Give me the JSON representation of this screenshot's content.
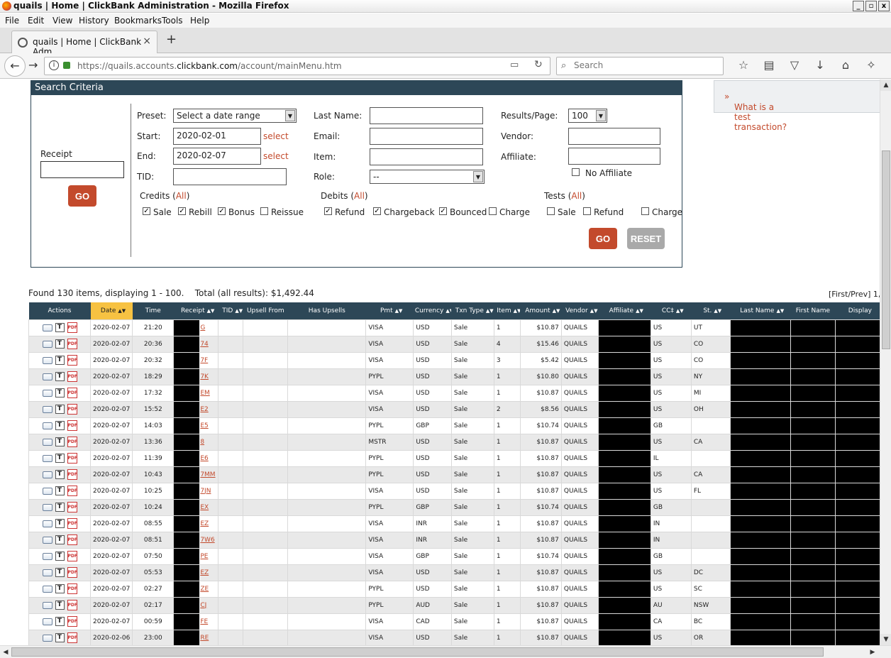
{
  "window": {
    "title": "quails | Home | ClickBank Administration - Mozilla Firefox",
    "buttons": [
      "_",
      "▫",
      "x"
    ]
  },
  "menu": [
    "File",
    "Edit",
    "View",
    "History",
    "Bookmarks",
    "Tools",
    "Help"
  ],
  "tab": {
    "label": "quails | Home | ClickBank Adm...",
    "close": "×",
    "new": "+"
  },
  "nav": {
    "url_prefix": "https://quails.accounts.",
    "url_domain": "clickbank.com",
    "url_path": "/account/mainMenu.htm",
    "search_placeholder": "Search"
  },
  "search_criteria": {
    "title": "Search Criteria",
    "receipt_label": "Receipt",
    "go": "GO",
    "reset": "RESET",
    "preset_label": "Preset:",
    "preset_value": "Select a date range",
    "start_label": "Start:",
    "start_value": "2020-02-01",
    "end_label": "End:",
    "end_value": "2020-02-07",
    "select_link": "select",
    "tid_label": "TID:",
    "last_name_label": "Last Name:",
    "email_label": "Email:",
    "item_label": "Item:",
    "role_label": "Role:",
    "role_value": "--",
    "results_label": "Results/Page:",
    "results_value": "100",
    "vendor_label": "Vendor:",
    "affiliate_label": "Affiliate:",
    "no_affiliate": "No Affiliate",
    "credits_label": "Credits (",
    "debits_label": "Debits (",
    "tests_label": "Tests (",
    "all": "All",
    "close_paren": ")",
    "credits": [
      {
        "label": "Sale",
        "checked": true
      },
      {
        "label": "Rebill",
        "checked": true
      },
      {
        "label": "Bonus",
        "checked": true
      },
      {
        "label": "Reissue",
        "checked": false
      }
    ],
    "debits": [
      {
        "label": "Refund",
        "checked": true
      },
      {
        "label": "Chargeback",
        "checked": true
      },
      {
        "label": "Bounced",
        "checked": true
      },
      {
        "label": "Charge",
        "checked": false
      }
    ],
    "tests": [
      {
        "label": "Sale",
        "checked": false
      },
      {
        "label": "Refund",
        "checked": false
      },
      {
        "label": "Charge",
        "checked": false
      }
    ]
  },
  "sidebar": {
    "link": "What is a test transaction?"
  },
  "results": {
    "summary": "Found 130 items, displaying 1 - 100.",
    "total": "Total (all results): $1,492.44",
    "pager": "[First/Prev] 1,",
    "columns": [
      "Actions",
      "Date",
      "Time",
      "Receipt",
      "TID",
      "Upsell From",
      "Has Upsells",
      "Pmt",
      "Currency",
      "Txn Type",
      "Item",
      "Amount",
      "Vendor",
      "Affiliate",
      "CC‡",
      "St.",
      "Last Name",
      "First Name",
      "Display"
    ],
    "rows": [
      {
        "date": "2020-02-07",
        "time": "21:20",
        "receipt": "G",
        "pmt": "VISA",
        "cur": "USD",
        "txn": "Sale",
        "item": "1",
        "amount": "$10.87",
        "vendor": "QUAILS",
        "cc": "US",
        "st": "UT"
      },
      {
        "date": "2020-02-07",
        "time": "20:36",
        "receipt": "74",
        "pmt": "VISA",
        "cur": "USD",
        "txn": "Sale",
        "item": "4",
        "amount": "$15.46",
        "vendor": "QUAILS",
        "cc": "US",
        "st": "CO"
      },
      {
        "date": "2020-02-07",
        "time": "20:32",
        "receipt": "7F",
        "pmt": "VISA",
        "cur": "USD",
        "txn": "Sale",
        "item": "3",
        "amount": "$5.42",
        "vendor": "QUAILS",
        "cc": "US",
        "st": "CO"
      },
      {
        "date": "2020-02-07",
        "time": "18:29",
        "receipt": "7K",
        "pmt": "PYPL",
        "cur": "USD",
        "txn": "Sale",
        "item": "1",
        "amount": "$10.80",
        "vendor": "QUAILS",
        "cc": "US",
        "st": "NY"
      },
      {
        "date": "2020-02-07",
        "time": "17:32",
        "receipt": "EM",
        "pmt": "VISA",
        "cur": "USD",
        "txn": "Sale",
        "item": "1",
        "amount": "$10.87",
        "vendor": "QUAILS",
        "cc": "US",
        "st": "MI"
      },
      {
        "date": "2020-02-07",
        "time": "15:52",
        "receipt": "E2",
        "pmt": "VISA",
        "cur": "USD",
        "txn": "Sale",
        "item": "2",
        "amount": "$8.56",
        "vendor": "QUAILS",
        "cc": "US",
        "st": "OH"
      },
      {
        "date": "2020-02-07",
        "time": "14:03",
        "receipt": "E5",
        "pmt": "PYPL",
        "cur": "GBP",
        "txn": "Sale",
        "item": "1",
        "amount": "$10.74",
        "vendor": "QUAILS",
        "cc": "GB",
        "st": ""
      },
      {
        "date": "2020-02-07",
        "time": "13:36",
        "receipt": "8",
        "pmt": "MSTR",
        "cur": "USD",
        "txn": "Sale",
        "item": "1",
        "amount": "$10.87",
        "vendor": "QUAILS",
        "cc": "US",
        "st": "CA"
      },
      {
        "date": "2020-02-07",
        "time": "11:39",
        "receipt": "E6",
        "pmt": "PYPL",
        "cur": "USD",
        "txn": "Sale",
        "item": "1",
        "amount": "$10.87",
        "vendor": "QUAILS",
        "cc": "IL",
        "st": ""
      },
      {
        "date": "2020-02-07",
        "time": "10:43",
        "receipt": "7MM",
        "pmt": "PYPL",
        "cur": "USD",
        "txn": "Sale",
        "item": "1",
        "amount": "$10.87",
        "vendor": "QUAILS",
        "cc": "US",
        "st": "CA"
      },
      {
        "date": "2020-02-07",
        "time": "10:25",
        "receipt": "7JN",
        "pmt": "VISA",
        "cur": "USD",
        "txn": "Sale",
        "item": "1",
        "amount": "$10.87",
        "vendor": "QUAILS",
        "cc": "US",
        "st": "FL"
      },
      {
        "date": "2020-02-07",
        "time": "10:24",
        "receipt": "EX",
        "pmt": "PYPL",
        "cur": "GBP",
        "txn": "Sale",
        "item": "1",
        "amount": "$10.74",
        "vendor": "QUAILS",
        "cc": "GB",
        "st": ""
      },
      {
        "date": "2020-02-07",
        "time": "08:55",
        "receipt": "EZ",
        "pmt": "VISA",
        "cur": "INR",
        "txn": "Sale",
        "item": "1",
        "amount": "$10.87",
        "vendor": "QUAILS",
        "cc": "IN",
        "st": ""
      },
      {
        "date": "2020-02-07",
        "time": "08:51",
        "receipt": "7W6",
        "pmt": "VISA",
        "cur": "INR",
        "txn": "Sale",
        "item": "1",
        "amount": "$10.87",
        "vendor": "QUAILS",
        "cc": "IN",
        "st": ""
      },
      {
        "date": "2020-02-07",
        "time": "07:50",
        "receipt": "PE",
        "pmt": "VISA",
        "cur": "GBP",
        "txn": "Sale",
        "item": "1",
        "amount": "$10.74",
        "vendor": "QUAILS",
        "cc": "GB",
        "st": ""
      },
      {
        "date": "2020-02-07",
        "time": "05:53",
        "receipt": "EZ",
        "pmt": "VISA",
        "cur": "USD",
        "txn": "Sale",
        "item": "1",
        "amount": "$10.87",
        "vendor": "QUAILS",
        "cc": "US",
        "st": "DC"
      },
      {
        "date": "2020-02-07",
        "time": "02:27",
        "receipt": "ZE",
        "pmt": "PYPL",
        "cur": "USD",
        "txn": "Sale",
        "item": "1",
        "amount": "$10.87",
        "vendor": "QUAILS",
        "cc": "US",
        "st": "SC"
      },
      {
        "date": "2020-02-07",
        "time": "02:17",
        "receipt": "CJ",
        "pmt": "PYPL",
        "cur": "AUD",
        "txn": "Sale",
        "item": "1",
        "amount": "$10.87",
        "vendor": "QUAILS",
        "cc": "AU",
        "st": "NSW"
      },
      {
        "date": "2020-02-07",
        "time": "00:59",
        "receipt": "FE",
        "pmt": "VISA",
        "cur": "CAD",
        "txn": "Sale",
        "item": "1",
        "amount": "$10.87",
        "vendor": "QUAILS",
        "cc": "CA",
        "st": "BC"
      },
      {
        "date": "2020-02-06",
        "time": "23:00",
        "receipt": "RE",
        "pmt": "VISA",
        "cur": "USD",
        "txn": "Sale",
        "item": "1",
        "amount": "$10.87",
        "vendor": "QUAILS",
        "cc": "US",
        "st": "OR"
      }
    ]
  }
}
